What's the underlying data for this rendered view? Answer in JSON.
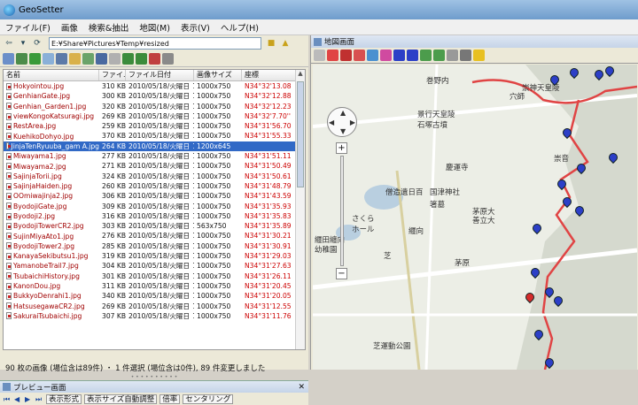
{
  "window": {
    "title": "GeoSetter"
  },
  "menu": [
    "ファイル(F)",
    "画像",
    "検索&抽出",
    "地図(M)",
    "表示(V)",
    "ヘルプ(H)"
  ],
  "path": "E:¥Share¥Pictures¥Temp¥resized",
  "columns": [
    "名前",
    "ファイ...",
    "ファイル日付",
    "画像サイズ",
    "座標"
  ],
  "files": [
    {
      "name": "Hokyointou.jpg",
      "size": "310 KB",
      "date": "2010/05/18/火曜日",
      "time": "14:46:32",
      "dim": "1000x750",
      "coord": "N34°32'13.08"
    },
    {
      "name": "GenhianGate.jpg",
      "size": "300 KB",
      "date": "2010/05/18/火曜日",
      "time": "14:48:10",
      "dim": "1000x750",
      "coord": "N34°32'12.88"
    },
    {
      "name": "Genhian_Garden1.jpg",
      "size": "320 KB",
      "date": "2010/05/18/火曜日",
      "time": "14:52:05",
      "dim": "1000x750",
      "coord": "N34°32'12.23"
    },
    {
      "name": "viewKongoKatsuragi.jpg",
      "size": "269 KB",
      "date": "2010/05/18/火曜日",
      "time": "15:00:02",
      "dim": "1000x750",
      "coord": "N34°32'7.70''"
    },
    {
      "name": "RestArea.jpg",
      "size": "259 KB",
      "date": "2010/05/18/火曜日",
      "time": "15:13:54",
      "dim": "1000x750",
      "coord": "N34°31'56.70"
    },
    {
      "name": "KuehikoDohyo.jpg",
      "size": "370 KB",
      "date": "2010/05/18/火曜日",
      "time": "15:15:48",
      "dim": "1000x750",
      "coord": "N34°31'55.33"
    },
    {
      "name": "JinjaTenRyuuba_gam A.jpg",
      "size": "264 KB",
      "date": "2010/05/18/火曜日",
      "time": "15:20:48",
      "dim": "1200x645",
      "coord": "",
      "selected": true
    },
    {
      "name": "Miwayama1.jpg",
      "size": "277 KB",
      "date": "2010/05/18/火曜日",
      "time": "15:24:55",
      "dim": "1000x750",
      "coord": "N34°31'51.11"
    },
    {
      "name": "Miwayama2.jpg",
      "size": "271 KB",
      "date": "2010/05/18/火曜日",
      "time": "15:26:33",
      "dim": "1000x750",
      "coord": "N34°31'50.49"
    },
    {
      "name": "SajinjaTorii.jpg",
      "size": "324 KB",
      "date": "2010/05/18/火曜日",
      "time": "15:28:30",
      "dim": "1000x750",
      "coord": "N34°31'50.61"
    },
    {
      "name": "SajinjaHaiden.jpg",
      "size": "260 KB",
      "date": "2010/05/18/火曜日",
      "time": "15:30:54",
      "dim": "1000x750",
      "coord": "N34°31'48.79"
    },
    {
      "name": "OOmiwajinja2.jpg",
      "size": "306 KB",
      "date": "2010/05/18/火曜日",
      "time": "15:41:37",
      "dim": "1000x750",
      "coord": "N34°31'43.59"
    },
    {
      "name": "ByodojiGate.jpg",
      "size": "309 KB",
      "date": "2010/05/18/火曜日",
      "time": "15:50:55",
      "dim": "1000x750",
      "coord": "N34°31'35.93"
    },
    {
      "name": "Byodoji2.jpg",
      "size": "316 KB",
      "date": "2010/05/18/火曜日",
      "time": "15:53:54",
      "dim": "1000x750",
      "coord": "N34°31'35.83"
    },
    {
      "name": "ByodojiTowerCR2.jpg",
      "size": "303 KB",
      "date": "2010/05/18/火曜日",
      "time": "15:54:05",
      "dim": "563x750",
      "coord": "N34°31'35.89"
    },
    {
      "name": "SujinMiyaAto1.jpg",
      "size": "276 KB",
      "date": "2010/05/18/火曜日",
      "time": "16:03:14",
      "dim": "1000x750",
      "coord": "N34°31'30.21"
    },
    {
      "name": "ByodojiTower2.jpg",
      "size": "285 KB",
      "date": "2010/05/18/火曜日",
      "time": "16:03:28",
      "dim": "1000x750",
      "coord": "N34°31'30.91"
    },
    {
      "name": "KanayaSekibutsu1.jpg",
      "size": "319 KB",
      "date": "2010/05/18/火曜日",
      "time": "16:09:21",
      "dim": "1000x750",
      "coord": "N34°31'29.03"
    },
    {
      "name": "YamanobeTrail7.jpg",
      "size": "304 KB",
      "date": "2010/05/18/火曜日",
      "time": "16:11:37",
      "dim": "1000x750",
      "coord": "N34°31'27.63"
    },
    {
      "name": "TsubaichiHistory.jpg",
      "size": "301 KB",
      "date": "2010/05/18/火曜日",
      "time": "16:23:37",
      "dim": "1000x750",
      "coord": "N34°31'26.11"
    },
    {
      "name": "KanonDou.jpg",
      "size": "311 KB",
      "date": "2010/05/18/火曜日",
      "time": "16:25:37",
      "dim": "1000x750",
      "coord": "N34°31'20.45"
    },
    {
      "name": "BukkyoDenrahi1.jpg",
      "size": "340 KB",
      "date": "2010/05/18/火曜日",
      "time": "16:37:36",
      "dim": "1000x750",
      "coord": "N34°31'20.05"
    },
    {
      "name": "HatsusegawaCR2.jpg",
      "size": "269 KB",
      "date": "2010/05/18/火曜日",
      "time": "16:41:20",
      "dim": "1000x750",
      "coord": "N34°31'12.55"
    },
    {
      "name": "SakuraiTsubaichi.jpg",
      "size": "307 KB",
      "date": "2010/05/18/火曜日",
      "time": "16:42:11",
      "dim": "1000x750",
      "coord": "N34°31'11.76"
    }
  ],
  "status": "90 枚の画像 (場位含は89件) ・ 1 件選択 (場位含は0件), 89 件変更しました",
  "preview": {
    "title": "プレビュー画面",
    "btn1": "表示形式",
    "btn2": "表示サイズ自動調整",
    "btn3": "倍率",
    "btn4": "センタリング"
  },
  "map": {
    "title": "地図画面",
    "labels": [
      "巻野内",
      "穴師",
      "景行天皇陵",
      "石塚古墳",
      "崇神天皇陵",
      "慶運寺",
      "僧造遺日百",
      "箸墓",
      "国津神社",
      "善立大",
      "茅原大",
      "さくら",
      "ホール",
      "纒向",
      "纒田纏向",
      "幼稚園",
      "芝",
      "茅原",
      "芝運動公園",
      "崇音"
    ]
  },
  "colors": {
    "route": "#e04444",
    "marker": "#2c3fc7",
    "selected_marker": "#d42a2a",
    "selection": "#3169c6"
  }
}
